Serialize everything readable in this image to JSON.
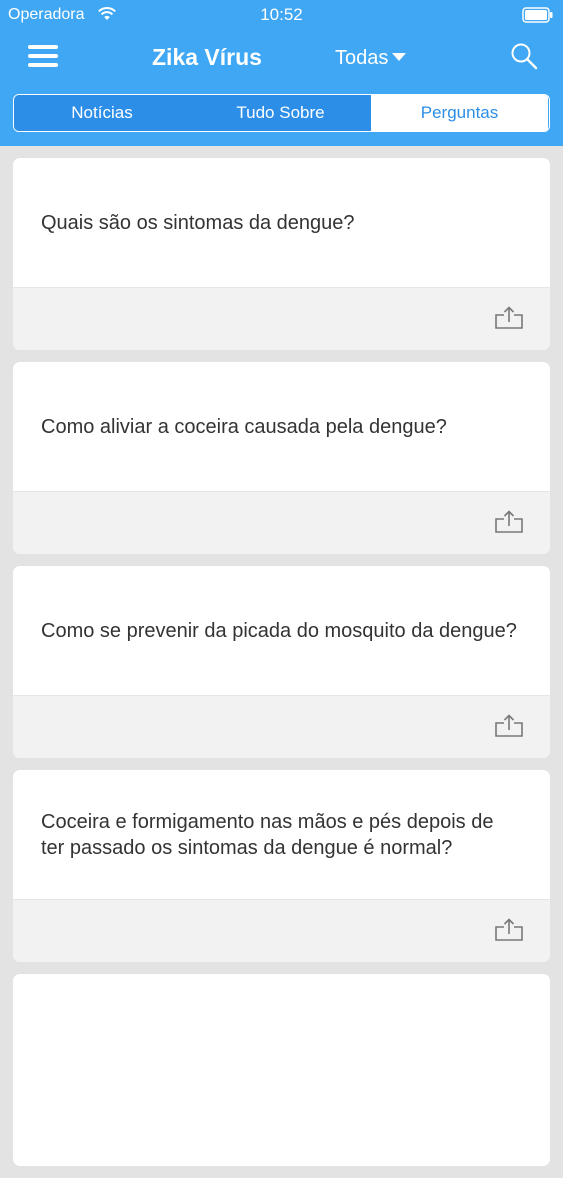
{
  "status_bar": {
    "carrier": "Operadora",
    "time": "10:52"
  },
  "nav": {
    "title": "Zika Vírus",
    "filter": "Todas"
  },
  "tabs": [
    {
      "label": "Notícias",
      "active": false
    },
    {
      "label": "Tudo Sobre",
      "active": false
    },
    {
      "label": "Perguntas",
      "active": true
    }
  ],
  "questions": [
    "Quais são os sintomas da dengue?",
    "Como aliviar a coceira causada pela dengue?",
    "Como se prevenir da picada do mosquito da dengue?",
    "Coceira e formigamento nas mãos e pés depois de ter passado os sintomas da dengue é normal?",
    ""
  ],
  "icons": {
    "menu": "hamburger-icon",
    "filter_caret": "caret-down-icon",
    "search": "search-icon",
    "share": "share-icon",
    "wifi": "wifi-icon",
    "battery": "battery-icon"
  },
  "colors": {
    "header": "#3fa7f3",
    "tab_inactive": "#2d8ee8",
    "background": "#e3e3e3",
    "text": "#333333"
  }
}
